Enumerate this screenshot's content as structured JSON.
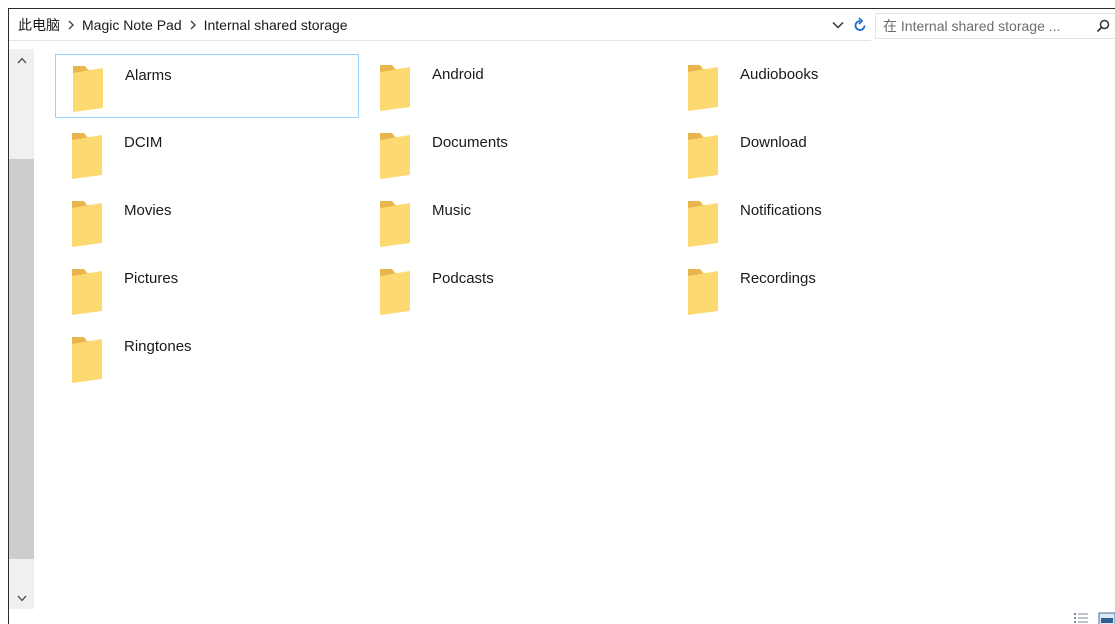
{
  "breadcrumb": {
    "items": [
      "此电脑",
      "Magic Note Pad",
      "Internal shared storage"
    ],
    "separator_icon": "chevron-right-icon"
  },
  "address_controls": {
    "dropdown_icon": "chevron-down-icon",
    "refresh_icon": "refresh-icon"
  },
  "search": {
    "placeholder": "在 Internal shared storage ...",
    "icon": "search-icon"
  },
  "scrollbar": {
    "up_icon": "chevron-up-icon",
    "down_icon": "chevron-down-icon"
  },
  "folders": [
    {
      "name": "Alarms",
      "selected": true
    },
    {
      "name": "Android",
      "selected": false
    },
    {
      "name": "Audiobooks",
      "selected": false
    },
    {
      "name": "DCIM",
      "selected": false
    },
    {
      "name": "Documents",
      "selected": false
    },
    {
      "name": "Download",
      "selected": false
    },
    {
      "name": "Movies",
      "selected": false
    },
    {
      "name": "Music",
      "selected": false
    },
    {
      "name": "Notifications",
      "selected": false
    },
    {
      "name": "Pictures",
      "selected": false
    },
    {
      "name": "Podcasts",
      "selected": false
    },
    {
      "name": "Recordings",
      "selected": false
    },
    {
      "name": "Ringtones",
      "selected": false
    }
  ],
  "view_buttons": [
    "details-view-icon",
    "large-icons-view-icon"
  ],
  "colors": {
    "folder_back": "#e8b64a",
    "folder_front": "#fcd971",
    "selection_border": "#99d1ff",
    "accent_blue": "#1f6fc5"
  }
}
